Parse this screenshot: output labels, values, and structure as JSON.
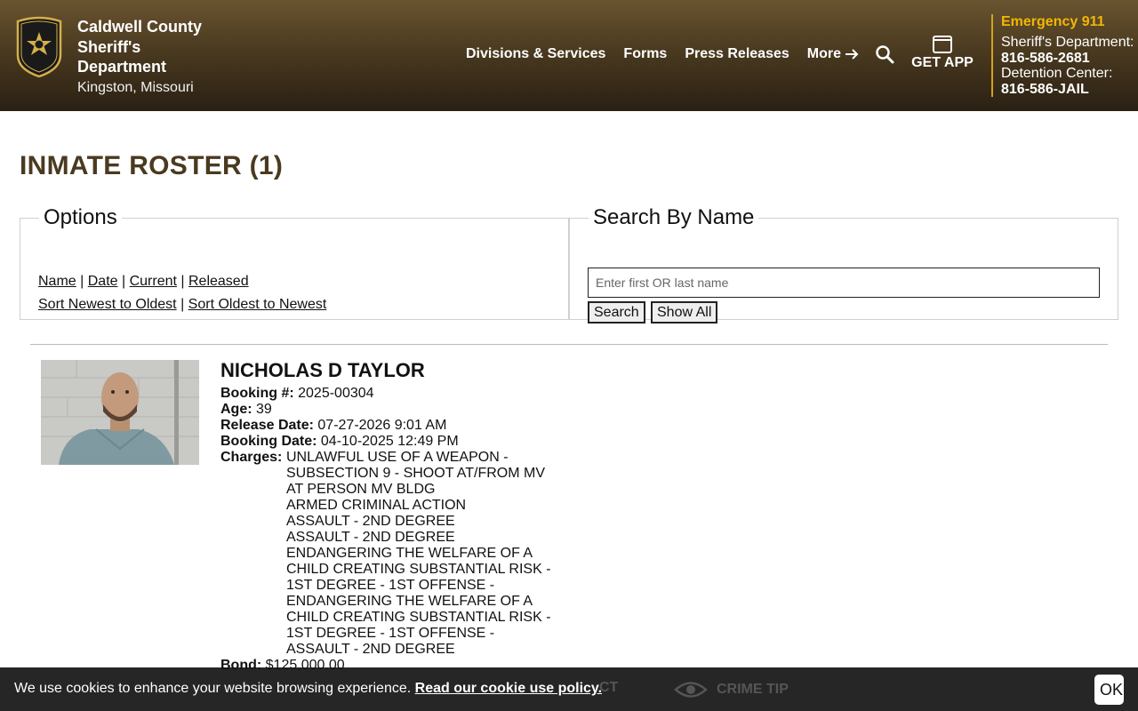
{
  "header": {
    "agency_name": "Caldwell County Sheriff's Department",
    "location": "Kingston, Missouri",
    "nav": {
      "divisions": "Divisions & Services",
      "forms": "Forms",
      "press": "Press Releases",
      "more": "More"
    },
    "get_app": "GET APP",
    "contact": {
      "emergency": "Emergency 911",
      "sheriff_label": "Sheriff's Department:",
      "sheriff_number": "816-586-2681",
      "detention_label": "Detention Center:",
      "detention_number": "816-586-JAIL"
    }
  },
  "main": {
    "title": "INMATE ROSTER (1)",
    "options": {
      "legend": "Options",
      "name": "Name",
      "date": "Date",
      "current": "Current",
      "released": "Released",
      "sort_newest": "Sort Newest to Oldest",
      "sort_oldest": "Sort Oldest to Newest"
    },
    "search": {
      "legend": "Search By Name",
      "placeholder": "Enter first OR last name",
      "search_button": "Search",
      "show_all_button": "Show All"
    }
  },
  "inmate": {
    "name": "NICHOLAS D TAYLOR",
    "booking_label": "Booking #:",
    "booking_number": "2025-00304",
    "age_label": "Age:",
    "age": "39",
    "release_label": "Release Date:",
    "release_date": "07-27-2026 9:01 AM",
    "booking_date_label": "Booking Date:",
    "booking_date": "04-10-2025 12:49 PM",
    "charges_label": "Charges:",
    "charges": [
      "UNLAWFUL USE OF A WEAPON - SUBSECTION 9 - SHOOT AT/FROM MV AT PERSON MV BLDG",
      "ARMED CRIMINAL ACTION",
      "ASSAULT - 2ND DEGREE",
      "ASSAULT - 2ND DEGREE",
      "ENDANGERING THE WELFARE OF A CHILD CREATING SUBSTANTIAL RISK - 1ST DEGREE - 1ST OFFENSE -",
      "ENDANGERING THE WELFARE OF A CHILD CREATING SUBSTANTIAL RISK - 1ST DEGREE - 1ST OFFENSE -",
      "ASSAULT - 2ND DEGREE"
    ],
    "bond_label": "Bond:",
    "bond": "$125,000.00"
  },
  "cookie": {
    "text": "We use cookies to enhance your website browsing experience.",
    "link": "Read our cookie use policy.",
    "ok": "OK",
    "hidden_contact": "CT",
    "hidden_tip": "CRIME TIP"
  },
  "colors": {
    "header_brown": "#4a3a20",
    "emergency_gold": "#f2b705",
    "title_brown": "#4a3a20"
  },
  "icons": [
    "sheriff-badge-icon",
    "arrow-right-icon",
    "search-icon",
    "phone-icon",
    "eye-icon"
  ]
}
